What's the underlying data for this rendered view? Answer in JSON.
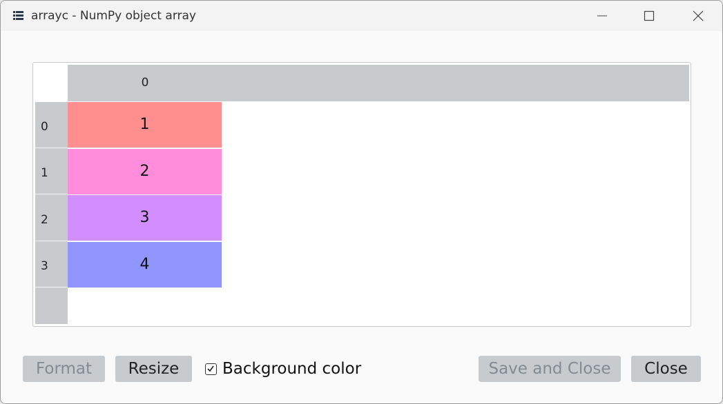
{
  "window": {
    "title": "arrayc - NumPy object array",
    "icon": "table-list-icon",
    "controls": [
      "minimize-icon",
      "maximize-icon",
      "close-icon"
    ]
  },
  "table": {
    "column_headers": [
      "0"
    ],
    "rows": [
      {
        "header": "0",
        "value": "1",
        "color": "#ff8e8e"
      },
      {
        "header": "1",
        "value": "2",
        "color": "#ff8ddc"
      },
      {
        "header": "2",
        "value": "3",
        "color": "#d28eff"
      },
      {
        "header": "3",
        "value": "4",
        "color": "#9196ff"
      }
    ]
  },
  "footer": {
    "format_label": "Format",
    "resize_label": "Resize",
    "background_color_label": "Background color",
    "background_color_checked": true,
    "save_close_label": "Save and Close",
    "close_label": "Close"
  },
  "colors": {
    "header_bg": "#c8cbce",
    "button_bg": "#c8cbce",
    "disabled_text": "#838b93"
  }
}
